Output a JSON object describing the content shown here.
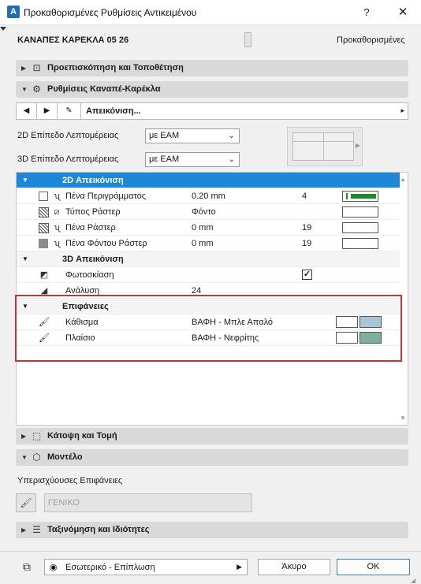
{
  "window": {
    "title": "Προκαθορισμένες Ρυθμίσεις Αντικειμένου",
    "help": "?",
    "close": "✕"
  },
  "header": {
    "object_name": "ΚΑΝΑΠΕΣ ΚΑΡΕΚΛΑ 05 26",
    "status": "Προκαθορισμένες"
  },
  "panels": {
    "preview_positioning": "Προεπισκόπηση και Τοποθέτηση",
    "sofa_chair_settings": "Ρυθμίσεις Καναπέ-Καρέκλα",
    "floor_plan_section": "Κάτοψη και Τομή",
    "model": "Μοντέλο",
    "classification": "Ταξινόμηση και Ιδιότητες"
  },
  "nav": {
    "prev": "◀",
    "next": "▶",
    "label": "Απεικόνιση...",
    "more": "▸"
  },
  "fields": {
    "detail_2d_label": "2D Επίπεδο Λεπτομέρειας",
    "detail_2d_value": "με ΕΑΜ",
    "detail_3d_label": "3D Επίπεδο Λεπτομέρειας",
    "detail_3d_value": "με ΕΑΜ"
  },
  "list": {
    "group_2d": "2D Απεικόνιση",
    "contour_pen_label": "Πένα Περιγράμματος",
    "contour_pen_value": "0.20 mm",
    "contour_pen_num": "4",
    "hatch_type_label": "Τύπος Ράστερ",
    "hatch_type_value": "Φόντο",
    "hatch_pen_label": "Πένα Ράστερ",
    "hatch_pen_value": "0 mm",
    "hatch_pen_num": "19",
    "hatch_bg_pen_label": "Πένα Φόντου Ράστερ",
    "hatch_bg_pen_value": "0 mm",
    "hatch_bg_pen_num": "19",
    "group_3d": "3D Απεικόνιση",
    "shading_label": "Φωτοσκίαση",
    "shading_check": "✓",
    "resolution_label": "Ανάλυση",
    "resolution_value": "24",
    "group_surfaces": "Επιφάνειες",
    "seat_label": "Κάθισμα",
    "seat_value": "ΒΑΦΗ - Μπλε Απαλό",
    "frame_label": "Πλαίσιο",
    "frame_value": "ΒΑΦΗ - Νεφρίτης",
    "seat_color": "#a9c6d8",
    "frame_color": "#7fae9a",
    "pen_color": "#1f8a2b",
    "selected_color": "#1e88d8",
    "highlight_color": "#d32f2f"
  },
  "model": {
    "override_surfaces_label": "Υπερισχύουσες Επιφάνειες",
    "surface_value": "ΓΕΝΙΚΟ"
  },
  "footer": {
    "view_label": "Εσωτερικό - Επίπλωση",
    "cancel": "Άκυρο",
    "ok": "OK"
  }
}
